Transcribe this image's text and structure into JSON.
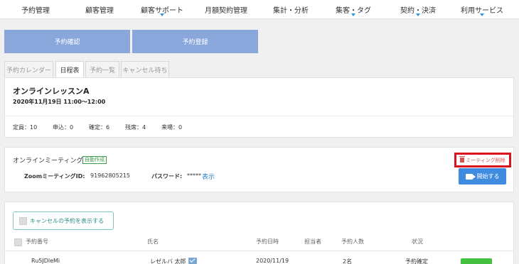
{
  "nav": [
    {
      "label": "予約管理",
      "caret": false
    },
    {
      "label": "顧客管理",
      "caret": false
    },
    {
      "label": "顧客サポート",
      "caret": true
    },
    {
      "label": "月額契約管理",
      "caret": false
    },
    {
      "label": "集計・分析",
      "caret": false
    },
    {
      "label": "集客・タグ",
      "caret": true
    },
    {
      "label": "契約・決済",
      "caret": true
    },
    {
      "label": "利用サービス",
      "caret": true
    }
  ],
  "actions": {
    "confirm": "予約確認",
    "register": "予約登録"
  },
  "tabs": [
    "予約カレンダー",
    "日程表",
    "予約一覧",
    "キャンセル待ち"
  ],
  "lesson": {
    "title": "オンラインレッスンA",
    "datetime": "2020年11月19日 11:00〜12:00",
    "stats": [
      "定員：10",
      "申込：0",
      "確定：6",
      "残席：4",
      "来場：0"
    ]
  },
  "meeting": {
    "title": "オンラインミーティング",
    "badge": "自動作成",
    "zoom_label": "ZoomミーティングID:",
    "zoom_id": "91962805215",
    "password_label": "パスワード:",
    "password_masked": "*****",
    "show_link": "表示",
    "delete_label": "ミーティング削除",
    "start_label": "開始する"
  },
  "reservations": {
    "toggle_label": "キャンセルの予約を表示する",
    "headers": [
      "予約番号",
      "氏名",
      "予約日時",
      "担当者",
      "予約人数",
      "状況"
    ],
    "row": {
      "number": "Ru5JDleMi",
      "name": "レゼルバ 太郎",
      "date": "2020/11/19",
      "count": "2名",
      "status": "予約確定"
    }
  }
}
